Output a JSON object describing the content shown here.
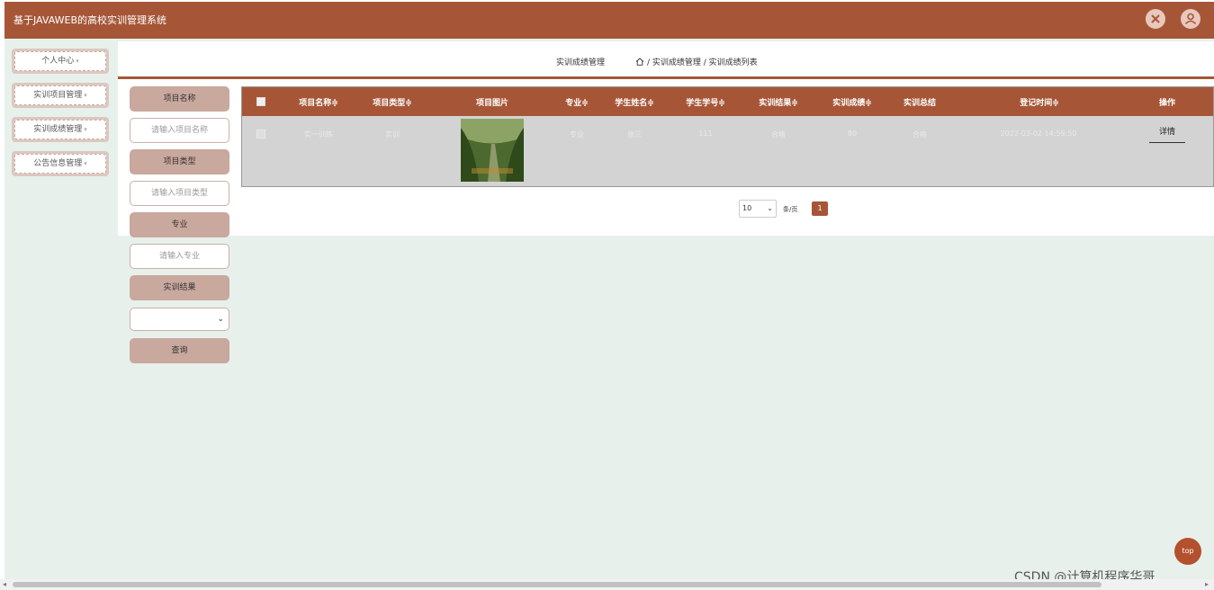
{
  "header": {
    "title": "基于JAVAWEB的高校实训管理系统",
    "icons": [
      "close-icon",
      "user-icon"
    ]
  },
  "sidebar": {
    "items": [
      {
        "label": "个人中心"
      },
      {
        "label": "实训项目管理"
      },
      {
        "label": "实训成绩管理"
      },
      {
        "label": "公告信息管理"
      }
    ]
  },
  "breadcrumb": {
    "section": "实训成绩管理",
    "path": "/ 实训成绩管理 / 实训成绩列表"
  },
  "search": {
    "project_name_label": "项目名称",
    "project_name_placeholder": "请输入项目名称",
    "project_type_label": "项目类型",
    "project_type_placeholder": "请输入项目类型",
    "major_label": "专业",
    "major_placeholder": "请输入专业",
    "result_label": "实训结果",
    "result_value": "",
    "query_button": "查询"
  },
  "table": {
    "columns": [
      "项目名称≑",
      "项目类型≑",
      "项目图片",
      "专业≑",
      "学生姓名≑",
      "学生学号≑",
      "实训结果≑",
      "实训成绩≑",
      "实训总结",
      "登记时间≑",
      "操作"
    ],
    "rows": [
      {
        "project_name": "实一训练",
        "project_type": "实训",
        "major": "专业",
        "student_name": "张三",
        "student_id": "111",
        "result": "合格",
        "score": "80",
        "summary": "合格",
        "time": "2022-03-02 14:59:50",
        "action": "详情"
      }
    ]
  },
  "pagination": {
    "page_size": "10",
    "page_size_suffix": "条/页",
    "current_page": "1"
  },
  "top_button": "top",
  "watermark": "CSDN @计算机程序华哥",
  "colors": {
    "accent": "#a65637",
    "background": "#e8f0ec"
  }
}
